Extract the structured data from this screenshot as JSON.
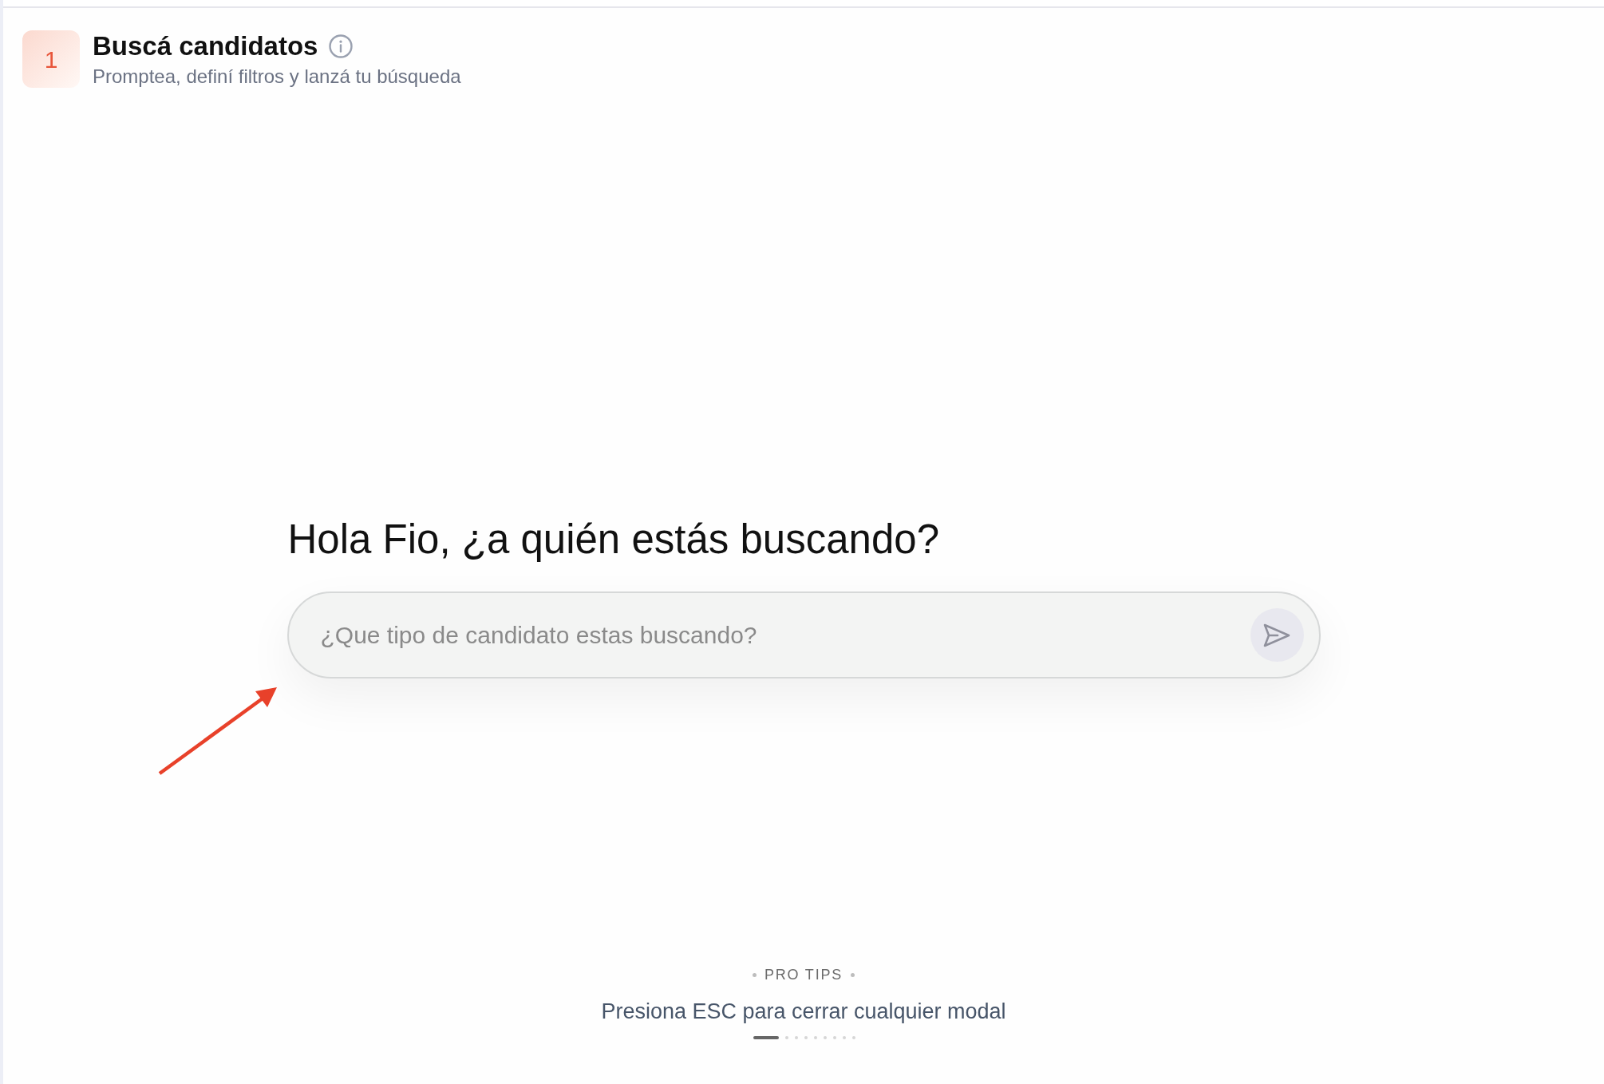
{
  "header": {
    "step": "1",
    "title": "Buscá candidatos",
    "subtitle": "Promptea, definí filtros y lanzá tu búsqueda"
  },
  "prompt": {
    "greeting": "Hola Fio, ¿a quién estás buscando?",
    "placeholder": "¿Que tipo de candidato estas buscando?"
  },
  "pro_tips": {
    "label": "PRO TIPS",
    "tip": "Presiona ESC para cerrar cualquier modal",
    "pages": [
      {
        "selected": true
      },
      {
        "selected": false
      },
      {
        "selected": false
      },
      {
        "selected": false
      },
      {
        "selected": false
      },
      {
        "selected": false
      },
      {
        "selected": false
      },
      {
        "selected": false
      },
      {
        "selected": false
      }
    ]
  }
}
